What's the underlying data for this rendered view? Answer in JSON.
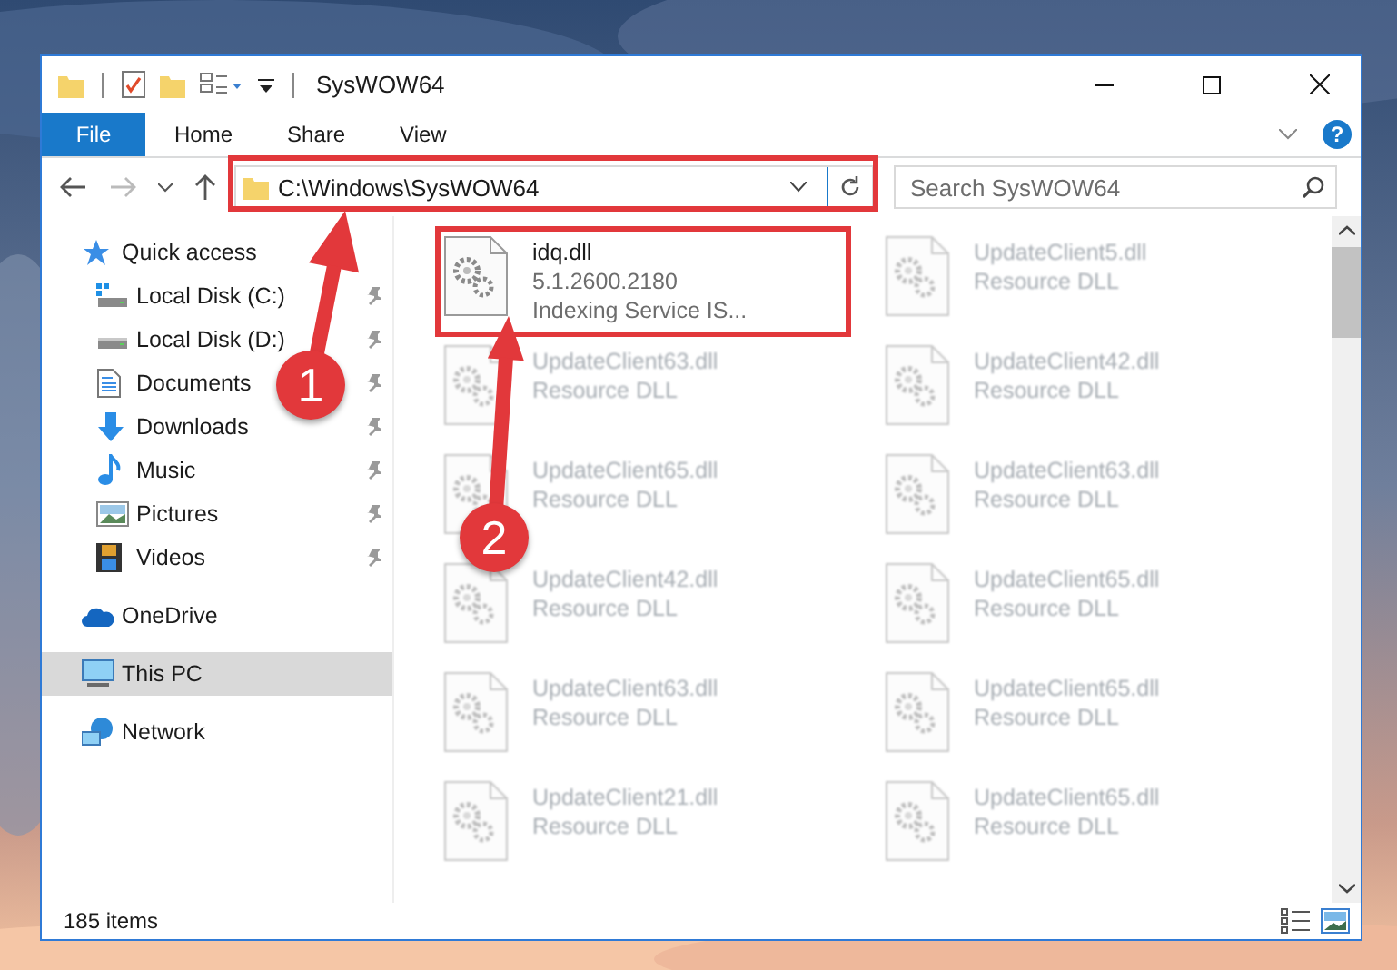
{
  "window": {
    "title": "SysWOW64"
  },
  "ribbon_tabs": [
    {
      "label": "File",
      "kind": "file-menu"
    },
    {
      "label": "Home",
      "kind": "tab"
    },
    {
      "label": "Share",
      "kind": "tab"
    },
    {
      "label": "View",
      "kind": "tab"
    }
  ],
  "help_button": "?",
  "address": {
    "value": "C:\\Windows\\SysWOW64"
  },
  "search": {
    "placeholder": "Search SysWOW64"
  },
  "nav": [
    {
      "label": "Quick access",
      "selected": false,
      "children": [
        {
          "label": "Local Disk (C:)",
          "selected": false,
          "pinned": true
        },
        {
          "label": "Local Disk (D:)",
          "selected": false,
          "pinned": true
        },
        {
          "label": "Documents",
          "selected": false,
          "pinned": true
        },
        {
          "label": "Downloads",
          "selected": false,
          "pinned": true
        },
        {
          "label": "Music",
          "selected": false,
          "pinned": true
        },
        {
          "label": "Pictures",
          "selected": false,
          "pinned": true
        },
        {
          "label": "Videos",
          "selected": false,
          "pinned": true
        }
      ]
    },
    {
      "label": "OneDrive",
      "selected": false
    },
    {
      "label": "This PC",
      "selected": true
    },
    {
      "label": "Network",
      "selected": false
    }
  ],
  "files": [
    {
      "name": "idq.dll",
      "details": [
        "5.1.2600.2180",
        "Indexing Service IS..."
      ],
      "blurred": false
    },
    {
      "name": "UpdateClient5.dll",
      "details": [
        "Resource DLL"
      ],
      "blurred": true
    },
    {
      "name": "UpdateClient63.dll",
      "details": [
        "Resource DLL"
      ],
      "blurred": true
    },
    {
      "name": "UpdateClient42.dll",
      "details": [
        "Resource DLL"
      ],
      "blurred": true
    },
    {
      "name": "UpdateClient65.dll",
      "details": [
        "Resource DLL"
      ],
      "blurred": true
    },
    {
      "name": "UpdateClient63.dll",
      "details": [
        "Resource DLL"
      ],
      "blurred": true
    },
    {
      "name": "UpdateClient42.dll",
      "details": [
        "Resource DLL"
      ],
      "blurred": true
    },
    {
      "name": "UpdateClient65.dll",
      "details": [
        "Resource DLL"
      ],
      "blurred": true
    },
    {
      "name": "UpdateClient63.dll",
      "details": [
        "Resource DLL"
      ],
      "blurred": true
    },
    {
      "name": "UpdateClient65.dll",
      "details": [
        "Resource DLL"
      ],
      "blurred": true
    },
    {
      "name": "UpdateClient21.dll",
      "details": [
        "Resource DLL"
      ],
      "blurred": true
    },
    {
      "name": "UpdateClient65.dll",
      "details": [
        "Resource DLL"
      ],
      "blurred": true
    }
  ],
  "status_bar": {
    "item_count": "185 items"
  },
  "annotations": [
    {
      "number": "1"
    },
    {
      "number": "2"
    }
  ]
}
